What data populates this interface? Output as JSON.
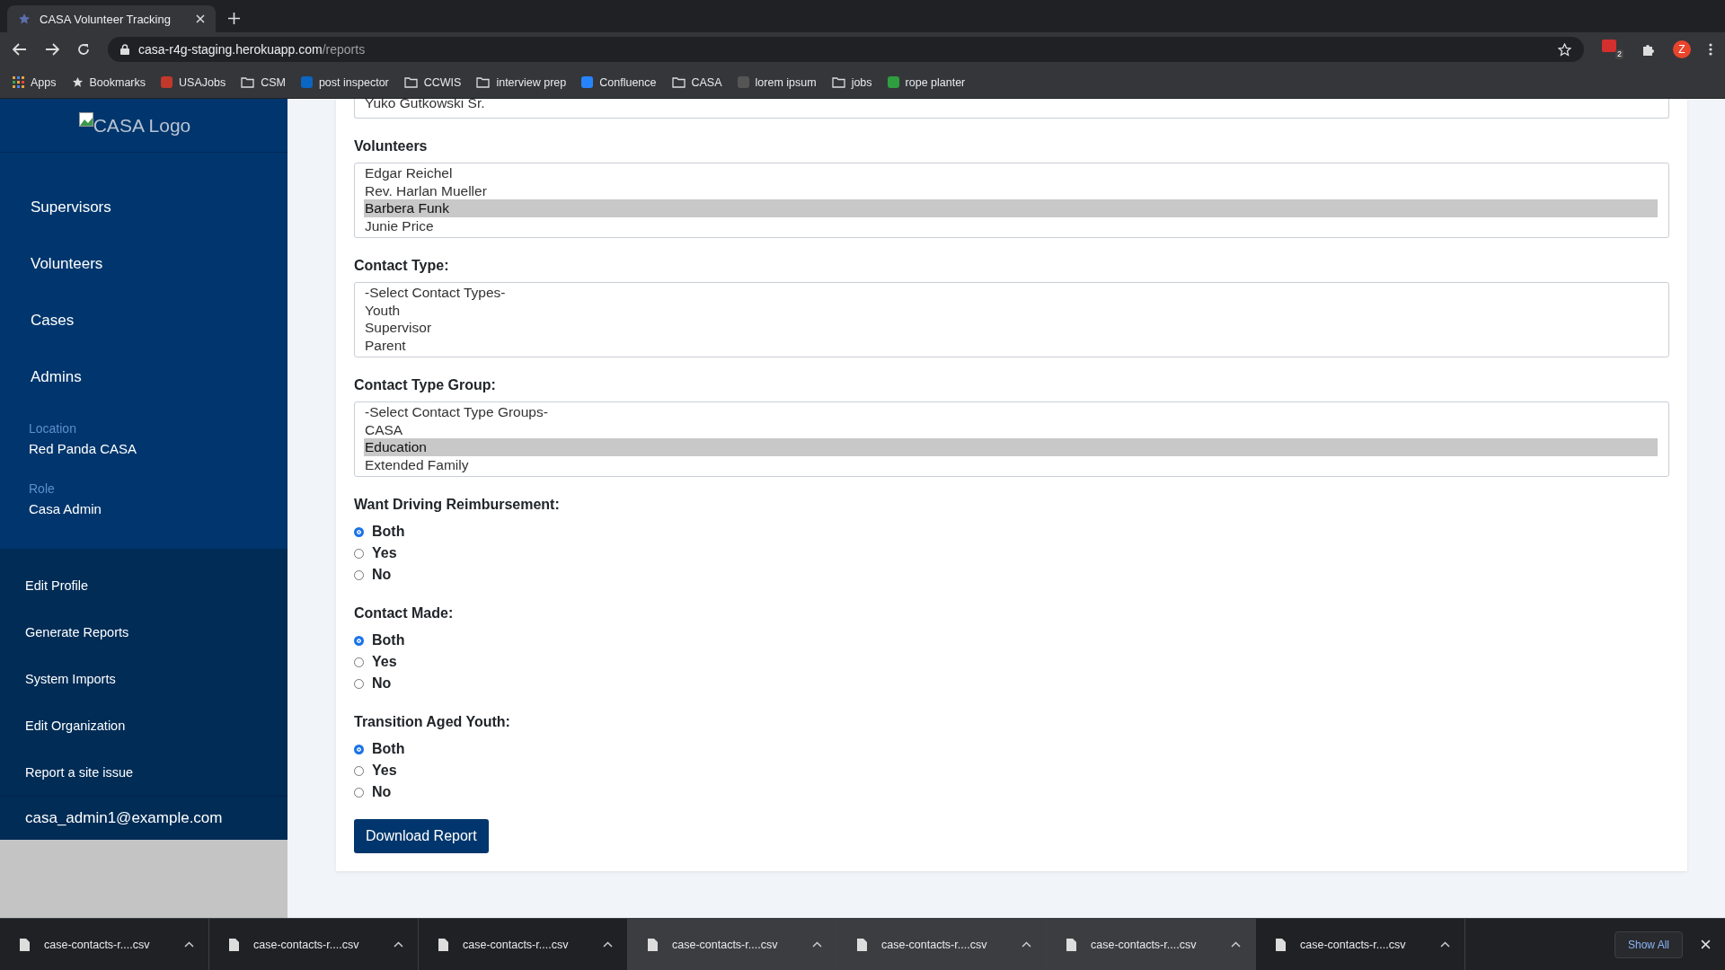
{
  "browser": {
    "tab_title": "CASA Volunteer Tracking",
    "url_host": "casa-r4g-staging.herokuapp.com",
    "url_path": "/reports",
    "extension_badge": "2",
    "avatar_letter": "Z",
    "bookmarks": [
      {
        "label": "Apps",
        "kind": "apps"
      },
      {
        "label": "Bookmarks",
        "kind": "star"
      },
      {
        "label": "USAJobs",
        "kind": "site",
        "color": "#c0392b"
      },
      {
        "label": "CSM",
        "kind": "folder"
      },
      {
        "label": "post inspector",
        "kind": "site",
        "color": "#0a66c2"
      },
      {
        "label": "CCWIS",
        "kind": "folder"
      },
      {
        "label": "interview prep",
        "kind": "folder"
      },
      {
        "label": "Confluence",
        "kind": "site",
        "color": "#2684ff"
      },
      {
        "label": "CASA",
        "kind": "folder"
      },
      {
        "label": "lorem ipsum",
        "kind": "site",
        "color": "#555555"
      },
      {
        "label": "jobs",
        "kind": "folder"
      },
      {
        "label": "rope planter",
        "kind": "site",
        "color": "#2e9e3f"
      }
    ]
  },
  "sidebar": {
    "logo_alt": "CASA Logo",
    "nav": [
      {
        "label": "Supervisors"
      },
      {
        "label": "Volunteers"
      },
      {
        "label": "Cases"
      },
      {
        "label": "Admins"
      }
    ],
    "info": [
      {
        "label": "Location",
        "value": "Red Panda CASA"
      },
      {
        "label": "Role",
        "value": "Casa Admin"
      }
    ],
    "links": [
      {
        "label": "Edit Profile"
      },
      {
        "label": "Generate Reports"
      },
      {
        "label": "System Imports"
      },
      {
        "label": "Edit Organization"
      },
      {
        "label": "Report a site issue"
      }
    ],
    "email": "casa_admin1@example.com"
  },
  "form": {
    "top_list": {
      "options": [
        {
          "label": "Yuko Gutkowski Sr.",
          "selected": false
        }
      ]
    },
    "lists": [
      {
        "label": "Volunteers",
        "options": [
          {
            "label": "Edgar Reichel",
            "selected": false
          },
          {
            "label": "Rev. Harlan Mueller",
            "selected": false
          },
          {
            "label": "Barbera Funk",
            "selected": true
          },
          {
            "label": "Junie Price",
            "selected": false
          }
        ]
      },
      {
        "label": "Contact Type:",
        "options": [
          {
            "label": "-Select Contact Types-",
            "selected": false
          },
          {
            "label": "Youth",
            "selected": false
          },
          {
            "label": "Supervisor",
            "selected": false
          },
          {
            "label": "Parent",
            "selected": false
          }
        ]
      },
      {
        "label": "Contact Type Group:",
        "options": [
          {
            "label": "-Select Contact Type Groups-",
            "selected": false
          },
          {
            "label": "CASA",
            "selected": false
          },
          {
            "label": "Education",
            "selected": true
          },
          {
            "label": "Extended Family",
            "selected": false
          }
        ]
      }
    ],
    "radio_groups": [
      {
        "label": "Want Driving Reimbursement:",
        "options": [
          {
            "label": "Both",
            "selected": true
          },
          {
            "label": "Yes",
            "selected": false
          },
          {
            "label": "No",
            "selected": false
          }
        ]
      },
      {
        "label": "Contact Made:",
        "options": [
          {
            "label": "Both",
            "selected": true
          },
          {
            "label": "Yes",
            "selected": false
          },
          {
            "label": "No",
            "selected": false
          }
        ]
      },
      {
        "label": "Transition Aged Youth:",
        "options": [
          {
            "label": "Both",
            "selected": true
          },
          {
            "label": "Yes",
            "selected": false
          },
          {
            "label": "No",
            "selected": false
          }
        ]
      }
    ],
    "submit": "Download Report"
  },
  "downloads": {
    "items": [
      {
        "name": "case-contacts-r....csv",
        "highlighted": false
      },
      {
        "name": "case-contacts-r....csv",
        "highlighted": false
      },
      {
        "name": "case-contacts-r....csv",
        "highlighted": false
      },
      {
        "name": "case-contacts-r....csv",
        "highlighted": true
      },
      {
        "name": "case-contacts-r....csv",
        "highlighted": true
      },
      {
        "name": "case-contacts-r....csv",
        "highlighted": true
      },
      {
        "name": "case-contacts-r....csv",
        "highlighted": false
      }
    ],
    "show_all": "Show All"
  }
}
